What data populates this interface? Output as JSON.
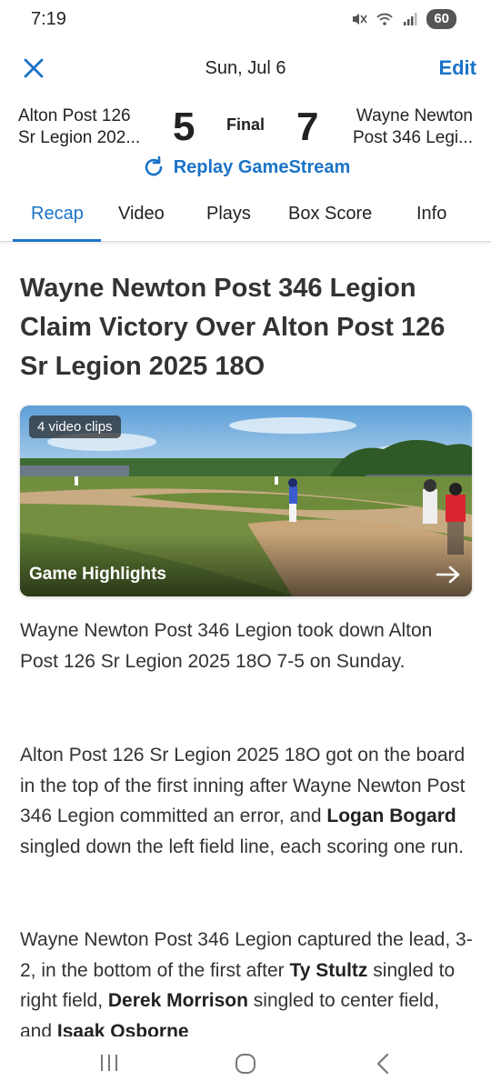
{
  "status": {
    "time": "7:19",
    "battery": "60"
  },
  "header": {
    "date": "Sun, Jul 6",
    "edit_label": "Edit"
  },
  "game": {
    "away_team": [
      "Alton Post 126",
      "Sr Legion 202..."
    ],
    "home_team": [
      "Wayne Newton",
      "Post 346 Legi..."
    ],
    "away_score": "5",
    "home_score": "7",
    "status": "Final"
  },
  "replay_label": "Replay GameStream",
  "tabs": [
    {
      "label": "Recap",
      "active": true
    },
    {
      "label": "Video",
      "active": false
    },
    {
      "label": "Plays",
      "active": false
    },
    {
      "label": "Box Score",
      "active": false
    },
    {
      "label": "Info",
      "active": false
    }
  ],
  "article": {
    "headline": "Wayne Newton Post 346 Legion Claim Victory Over Alton Post 126 Sr Legion 2025 18O",
    "video": {
      "badge": "4 video clips",
      "title": "Game Highlights"
    },
    "paragraphs": [
      {
        "pre": "Wayne Newton Post 346 Legion took down Alton Post 126 Sr Legion 2025 18O 7-5 on Sunday."
      },
      {
        "pre": "Alton Post 126 Sr Legion 2025 18O got on the board in the top of the first inning after Wayne Newton Post 346 Legion committed an error, and ",
        "player": "Logan Bogard",
        "post": " singled down the left field line, each scoring one run."
      },
      {
        "pre": "Wayne Newton Post 346 Legion captured the lead, 3-2, in the bottom of the first after ",
        "player1": "Ty Stultz",
        "mid1": " singled to right field, ",
        "player2": "Derek Morrison",
        "mid2": " singled to center field, and ",
        "player3": "Isaak Osborne",
        "post": ""
      }
    ]
  },
  "colors": {
    "accent": "#1a73c8",
    "text": "#333333"
  }
}
